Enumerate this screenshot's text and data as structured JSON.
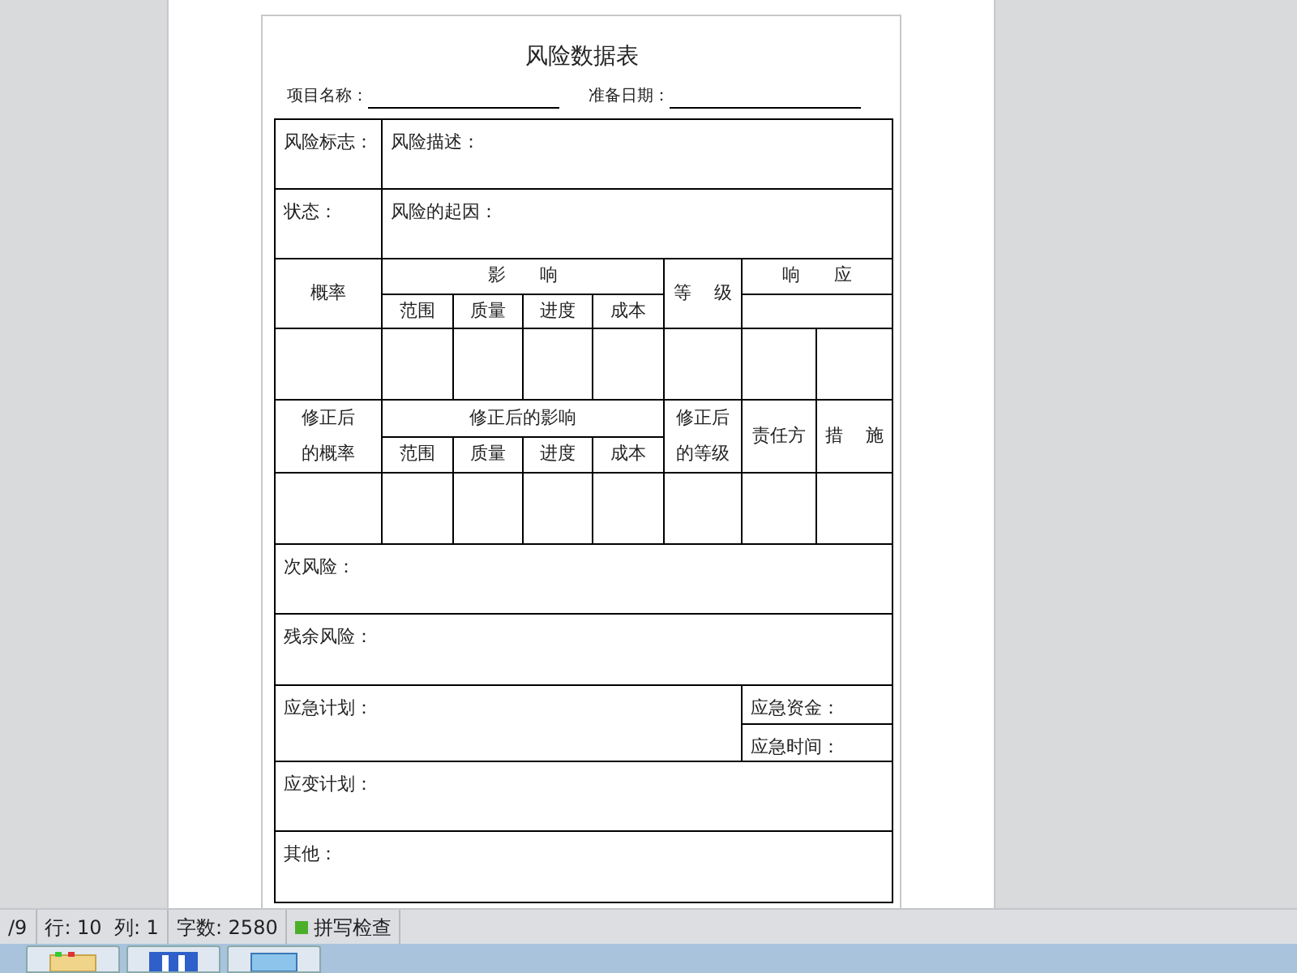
{
  "document": {
    "title": "风险数据表",
    "fields": [
      {
        "label": "项目名称："
      },
      {
        "label": "准备日期："
      }
    ],
    "table": {
      "rows": [
        [
          {
            "text": "风险标志：",
            "kind": "field"
          },
          {
            "text": "风险描述：",
            "kind": "field",
            "colspan": 7
          }
        ],
        [
          {
            "text": "状态：",
            "kind": "field"
          },
          {
            "text": "风险的起因：",
            "kind": "field",
            "colspan": 7
          }
        ],
        [
          {
            "lines": [
              "概率"
            ],
            "rowspan": 2
          },
          {
            "text": "影      响",
            "colspan": 4
          },
          {
            "lines": [
              "等    级"
            ],
            "rowspan": 2
          },
          {
            "text": "响      应",
            "colspan": 2
          }
        ],
        [
          {
            "text": "范围"
          },
          {
            "text": "质量"
          },
          {
            "text": "进度"
          },
          {
            "text": "成本"
          },
          {
            "colspan": 2
          }
        ],
        [
          {},
          {},
          {},
          {},
          {},
          {},
          {},
          {}
        ],
        [
          {
            "lines": [
              "修正后",
              "的概率"
            ],
            "rowspan": 2
          },
          {
            "text": "修正后的影响",
            "colspan": 4
          },
          {
            "lines": [
              "修正后",
              "的等级"
            ],
            "rowspan": 2
          },
          {
            "lines": [
              "责任方"
            ],
            "rowspan": 2
          },
          {
            "lines": [
              "措    施"
            ],
            "rowspan": 2
          }
        ],
        [
          {
            "text": "范围"
          },
          {
            "text": "质量"
          },
          {
            "text": "进度"
          },
          {
            "text": "成本"
          }
        ],
        [
          {},
          {},
          {},
          {},
          {},
          {},
          {},
          {}
        ],
        [
          {
            "text": "次风险：",
            "kind": "field",
            "colspan": 8
          }
        ],
        [
          {
            "text": "残余风险：",
            "kind": "field",
            "colspan": 8
          }
        ],
        [
          {
            "text": "应急计划：",
            "kind": "field",
            "colspan": 6,
            "rowspan": 2
          },
          {
            "text": "应急资金：",
            "kind": "field",
            "colspan": 2
          }
        ],
        [
          {
            "text": "应急时间：",
            "kind": "field",
            "colspan": 2
          }
        ],
        [
          {
            "text": "应变计划：",
            "kind": "field",
            "colspan": 8
          }
        ],
        [
          {
            "text": "其他：",
            "kind": "field",
            "colspan": 8
          }
        ]
      ]
    }
  },
  "status_bar": {
    "items": [
      {
        "text": "/9"
      },
      {
        "text": "行: 10  列: 1"
      },
      {
        "text": "字数: 2580"
      },
      {
        "text": "拼写检查",
        "kind": "spell"
      }
    ]
  },
  "taskbar": {
    "buttons": [
      {
        "kind": "folder",
        "selected": false
      },
      {
        "kind": "app",
        "selected": false
      },
      {
        "kind": "screen",
        "selected": false
      }
    ]
  }
}
